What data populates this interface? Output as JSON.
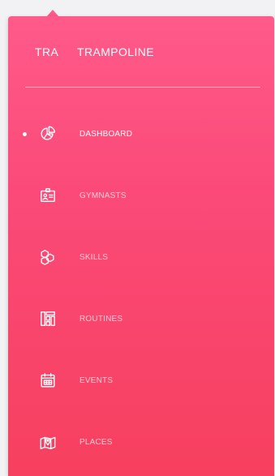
{
  "brand": {
    "short": "TRA",
    "name": "TRAMPOLINE"
  },
  "sidebar": {
    "active_index": 0,
    "items": [
      {
        "label": "DASHBOARD",
        "icon": "pie-chart-icon"
      },
      {
        "label": "GYMNASTS",
        "icon": "id-badge-icon"
      },
      {
        "label": "SKILLS",
        "icon": "hexagons-icon"
      },
      {
        "label": "ROUTINES",
        "icon": "layout-grid-icon"
      },
      {
        "label": "EVENTS",
        "icon": "calendar-icon"
      },
      {
        "label": "PLACES",
        "icon": "map-icon"
      }
    ]
  },
  "colors": {
    "gradient_top": "#ff5a8a",
    "gradient_bottom": "#f7405f",
    "page_background": "#f2f2f5",
    "text": "#ffffff"
  }
}
